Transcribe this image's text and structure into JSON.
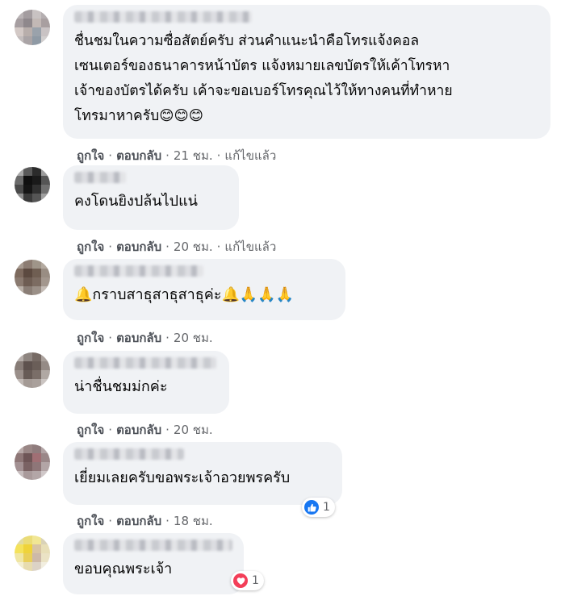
{
  "comments": [
    {
      "text": "ชื่นชมในความซื่อสัตย์ครับ ส่วนคำแนะนำคือโทรแจ้งคอล\nเซนเตอร์ของธนาคารหน้าบัตร แจ้งหมายเลขบัตรให้เค้าโทรหา\nเจ้าของบัตรได้ครับ เค้าจะขอเบอร์โทรคุณไว้ให้ทางคนที่ทำหาย\nโทรมาหาครับ😊😊😊",
      "like": "ถูกใจ",
      "reply": "ตอบกลับ",
      "time": "21 ชม.",
      "edited": "แก้ไขแล้ว"
    },
    {
      "text": "คงโดนยิงปล้นไปแน่",
      "like": "ถูกใจ",
      "reply": "ตอบกลับ",
      "time": "20 ชม.",
      "edited": "แก้ไขแล้ว"
    },
    {
      "text": "🔔กราบสาธุสาธุสาธุค่ะ🔔🙏🙏🙏",
      "like": "ถูกใจ",
      "reply": "ตอบกลับ",
      "time": "20 ชม."
    },
    {
      "text": "น่าชื่นชมม่กค่ะ",
      "like": "ถูกใจ",
      "reply": "ตอบกลับ",
      "time": "20 ชม."
    },
    {
      "text": "เยี่ยมเลยครับขอพระเจ้าอวยพรครับ",
      "like": "ถูกใจ",
      "reply": "ตอบกลับ",
      "time": "18 ชม.",
      "reaction": {
        "type": "like-icon",
        "count": "1"
      }
    },
    {
      "text": "ขอบคุณพระเจ้า",
      "reaction": {
        "type": "love-icon",
        "count": "1"
      }
    }
  ],
  "colors": {
    "bubble": "#f0f2f5",
    "meta": "#65676b",
    "like": "#1877f2",
    "love": "#f33e58"
  }
}
